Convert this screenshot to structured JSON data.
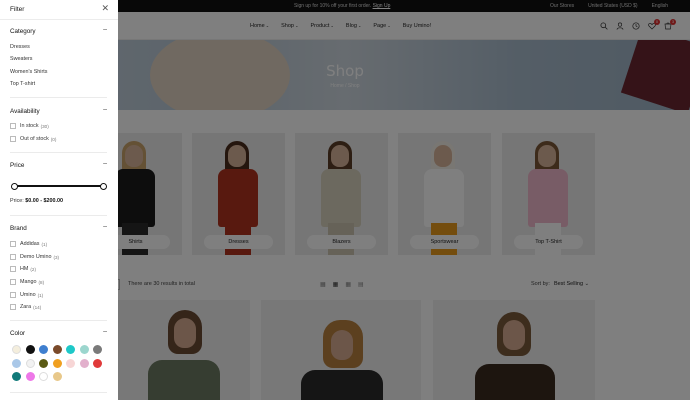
{
  "announcement": {
    "text": "Sign up for 10% off your first order.",
    "link": "Sign Up",
    "stores": "Our Stores",
    "currency": "United States (USD $)",
    "language": "English"
  },
  "nav": {
    "items": [
      "Home",
      "Shop",
      "Product",
      "Blog",
      "Page",
      "Buy Umino!"
    ],
    "cart_count": "3",
    "wishlist_count": "0"
  },
  "hero": {
    "title": "Shop",
    "breadcrumb": "Home  /  Shop"
  },
  "categories": [
    {
      "label": "Shirts",
      "top": "#1a1a1a",
      "bottom": "#2a2a2a",
      "hair": "#c9a26a"
    },
    {
      "label": "Dresses",
      "top": "#b0331f",
      "bottom": "#b0331f",
      "hair": "#4a2c1c"
    },
    {
      "label": "Blazers",
      "top": "#d8d2bf",
      "bottom": "#ccc5b0",
      "hair": "#5b3c26"
    },
    {
      "label": "Sportswear",
      "top": "#ffffff",
      "bottom": "#e89a1c",
      "hair": "#f3eee6"
    },
    {
      "label": "Top T-Shirt",
      "top": "#f0b8cc",
      "bottom": "#ffffff",
      "hair": "#7a5636"
    }
  ],
  "toolbar": {
    "results_text": "There are 30 results in total",
    "sort_label": "Sort by:",
    "sort_value": "Best Selling"
  },
  "products": [
    {
      "hair": "#6b4a33",
      "top": "#6c7a62"
    },
    {
      "hair": "#b8803f",
      "top": "#2b2b2b"
    },
    {
      "hair": "#7a5a3a",
      "top": "#3a2a1f"
    }
  ],
  "filter": {
    "title": "Filter",
    "category": {
      "title": "Category",
      "items": [
        "Dresses",
        "Sweaters",
        "Women's Shirts",
        "Top T-shirt"
      ]
    },
    "availability": {
      "title": "Availability",
      "items": [
        {
          "label": "In stock",
          "count": "(30)"
        },
        {
          "label": "Out of stock",
          "count": "(0)"
        }
      ]
    },
    "price": {
      "title": "Price",
      "label": "Price:",
      "range": "$0.00 - $200.00",
      "min_fraction": 0,
      "max_fraction": 1
    },
    "brand": {
      "title": "Brand",
      "items": [
        {
          "label": "Addidas",
          "count": "(1)"
        },
        {
          "label": "Demo Umino",
          "count": "(3)"
        },
        {
          "label": "HM",
          "count": "(2)"
        },
        {
          "label": "Mango",
          "count": "(8)"
        },
        {
          "label": "Umino",
          "count": "(1)"
        },
        {
          "label": "Zara",
          "count": "(14)"
        }
      ]
    },
    "color": {
      "title": "Color",
      "swatches": [
        "#f4eedd",
        "#111111",
        "#3f7fcf",
        "#7a4a2a",
        "#1ec8c8",
        "#9cd6ce",
        "#7a7a7a",
        "#aac8e8",
        "#f2f2f2",
        "#5a5a14",
        "#f0a020",
        "#f7d6d6",
        "#e2b0cc",
        "#e03a3a",
        "#117a7a",
        "#ee78e8",
        "#ffffff",
        "#e8c88a"
      ]
    }
  }
}
